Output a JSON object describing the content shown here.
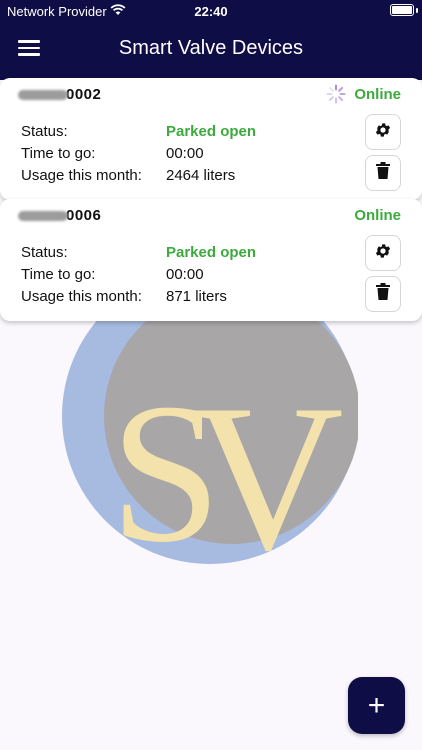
{
  "status_bar": {
    "carrier": "Network Provider",
    "time": "22:40"
  },
  "header": {
    "title": "Smart Valve Devices"
  },
  "logo": {
    "letter1": "S",
    "letter2": "V"
  },
  "labels": {
    "status": "Status:",
    "time_to_go": "Time to go:",
    "usage": "Usage this month:"
  },
  "devices": [
    {
      "id_suffix": "0002",
      "online": "Online",
      "status": "Parked open",
      "time_to_go": "00:00",
      "usage": "2464 liters"
    },
    {
      "id_suffix": "0006",
      "online": "Online",
      "status": "Parked open",
      "time_to_go": "00:00",
      "usage": "871 liters"
    }
  ],
  "fab": {
    "label": "+"
  },
  "colors": {
    "navy": "#0f0d46",
    "online_green": "#3daa3d",
    "logo_gold": "#f3e2ab",
    "logo_blue": "#9db2dd",
    "logo_gray": "#a9a6a7"
  }
}
